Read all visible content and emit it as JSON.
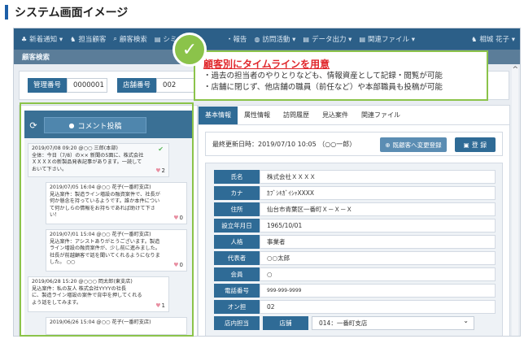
{
  "heading": {
    "title": "システム画面イメージ"
  },
  "navbar": {
    "items": [
      {
        "icon": "bell-icon",
        "glyph": "♣",
        "label": "新着通知 ▾"
      },
      {
        "icon": "users-icon",
        "glyph": "♞",
        "label": "担当顧客"
      },
      {
        "icon": "search-icon",
        "glyph": "⌕",
        "label": "顧客検索"
      },
      {
        "icon": "chart-icon",
        "glyph": "▤",
        "label": "シミュ"
      },
      {
        "icon": "report-icon",
        "glyph": "",
        "label": "・報告"
      },
      {
        "icon": "visit-icon",
        "glyph": "◍",
        "label": "訪問活動 ▾"
      },
      {
        "icon": "export-icon",
        "glyph": "▤",
        "label": "データ出力 ▾"
      },
      {
        "icon": "file-icon",
        "glyph": "▤",
        "label": "関連ファイル ▾"
      }
    ],
    "user": {
      "icon": "user-icon",
      "glyph": "♞",
      "label": "相城 花子 ▾"
    }
  },
  "subheader": {
    "title": "顧客検索"
  },
  "search": {
    "mgmt_label": "管理番号",
    "mgmt_value": "0000001",
    "store_label": "店舗番号",
    "store_value": "002"
  },
  "timeline": {
    "post_button": "コメント投稿",
    "posts": [
      {
        "text": "2019/07/08 09:20 @○○ 三郎(本部)\n全体：今日（7/8）の×× 新聞の5面に、株式会社\nＸＸＸＸの新製品発表記事があります。一読して\nおいて下さい。",
        "likes": "2",
        "checked": true
      },
      {
        "text": "2019/07/05 16:04 @○○ 花子(一番町支店)\n見込案件：製造ライン増設の融資案件で、社長が\n何か懸念を持っているようです。誰か本件につい\nて何かしらの情報をお持ちであれば助けて下さ\nい！",
        "likes": "0",
        "checked": false
      },
      {
        "text": "2019/07/01 15:04 @○○ 花子(一番町支店)\n見込案件：アシストありがとうございます。製造\nライン増設の融資案件が、少し前に進みました。\n社長が前越顧客で話を聞いてくれるようになりま\nした。        ○○",
        "likes": "0",
        "checked": false
      },
      {
        "text": "2019/06/28 15:20 @○○○ 岡太郎(東支店)\n見込案件：私の友人 株式会社YYYYの社長\nに、製造ライン増設の案件で背中を押してくれる\nよう話をしてみます。",
        "likes": "1",
        "checked": false
      },
      {
        "text": "2019/06/26 15:04 @○○ 花子(一番町支店)",
        "likes": "",
        "checked": false
      }
    ]
  },
  "tabs": [
    {
      "label": "基本情報",
      "active": true
    },
    {
      "label": "属性情報",
      "active": false
    },
    {
      "label": "訪問履歴",
      "active": false
    },
    {
      "label": "見込案件",
      "active": false
    },
    {
      "label": "関連ファイル",
      "active": false
    }
  ],
  "update": {
    "text": "最終更新日時：2019/07/10 10:05 （○○一郎）",
    "change_button": "既顧客へ変更登録",
    "save_button": "登 録"
  },
  "info": {
    "rows": [
      {
        "label": "氏名",
        "value": "株式会社ＸＸＸＸ"
      },
      {
        "label": "カナ",
        "value": "ｶﾌﾞｼｷｶﾞｲｼｬXXXX"
      },
      {
        "label": "住所",
        "value": "仙台市青葉区一番町Ｘ－Ｘ－Ｘ"
      },
      {
        "label": "設立年月日",
        "value": "1965/10/01"
      },
      {
        "label": "人格",
        "value": "事業者"
      },
      {
        "label": "代表者",
        "value": "○○太郎"
      },
      {
        "label": "会員",
        "value": "○"
      },
      {
        "label": "電話番号",
        "value": "999-999-9999"
      },
      {
        "label": "オン担",
        "value": "02"
      }
    ],
    "branch": {
      "label": "店内担当",
      "sub_label": "店舗",
      "value": "014：一番町支店"
    }
  },
  "callout": {
    "title": "顧客別にタイムラインを用意",
    "lines": [
      "・過去の担当者のやりとりなども、情報資産として記録・閲覧が可能",
      "・店舗に閉じず、他店舗の職員（前任など）や本部職員も投稿が可能"
    ]
  },
  "colors": {
    "accent": "#2f6b96",
    "highlight": "#8bc34a",
    "callout_title": "#e0262b"
  }
}
